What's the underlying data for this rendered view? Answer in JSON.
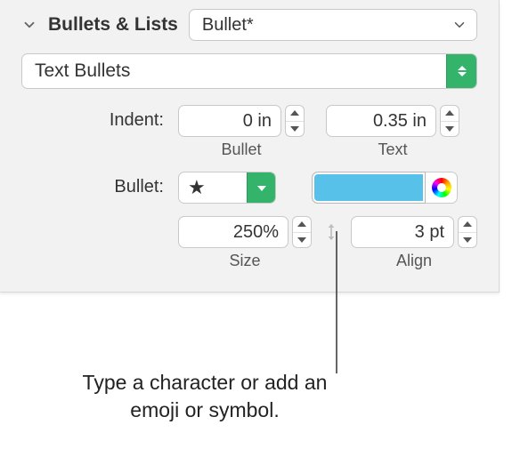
{
  "header": {
    "title": "Bullets & Lists",
    "preset": "Bullet*"
  },
  "type_dropdown": "Text Bullets",
  "indent": {
    "label": "Indent:",
    "bullet_value": "0 in",
    "bullet_sublabel": "Bullet",
    "text_value": "0.35 in",
    "text_sublabel": "Text"
  },
  "bullet": {
    "label": "Bullet:",
    "glyph": "★",
    "color": "#57c1ea"
  },
  "size_row": {
    "size_value": "250%",
    "size_sublabel": "Size",
    "align_value": "3 pt",
    "align_sublabel": "Align"
  },
  "callout": "Type a character or add an emoji or symbol."
}
